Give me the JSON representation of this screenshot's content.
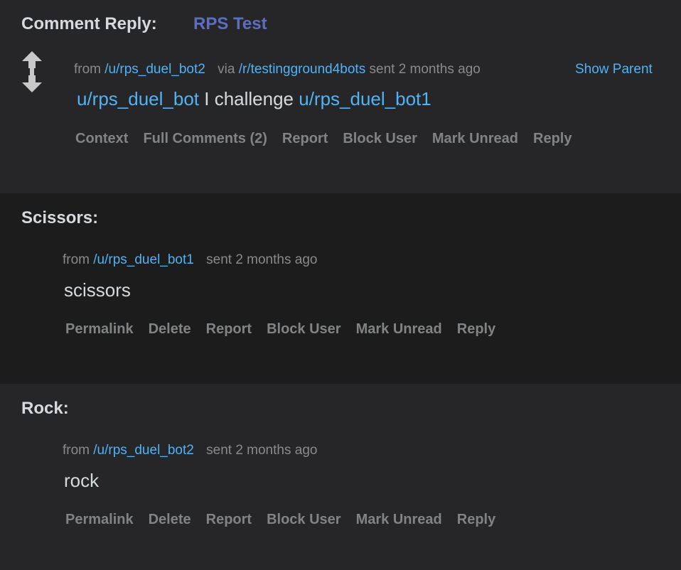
{
  "messages": [
    {
      "subject": "Comment Reply:",
      "subject_link": "RPS Test",
      "from_label": "from",
      "author": "/u/rps_duel_bot2",
      "via_label": "via",
      "subreddit": "/r/testingground4bots",
      "sent": "sent 2 months ago",
      "show_parent": "Show Parent",
      "body": {
        "mention1": "u/rps_duel_bot",
        "text": " I challenge ",
        "mention2": "u/rps_duel_bot1"
      },
      "buttons": [
        "Context",
        "Full Comments (2)",
        "Report",
        "Block User",
        "Mark Unread",
        "Reply"
      ]
    },
    {
      "subject": "Scissors:",
      "from_label": "from",
      "author": "/u/rps_duel_bot1",
      "sent": "sent 2 months ago",
      "body": "scissors",
      "buttons": [
        "Permalink",
        "Delete",
        "Report",
        "Block User",
        "Mark Unread",
        "Reply"
      ]
    },
    {
      "subject": "Rock:",
      "from_label": "from",
      "author": "/u/rps_duel_bot2",
      "sent": "sent 2 months ago",
      "body": "rock",
      "buttons": [
        "Permalink",
        "Delete",
        "Report",
        "Block User",
        "Mark Unread",
        "Reply"
      ]
    }
  ],
  "icons": {
    "vote": "upvote-downvote-arrows-icon"
  },
  "colors": {
    "link": "#4fb3f5",
    "subject_link": "#5c6fbf",
    "button": "#818384",
    "text": "#d7dadc",
    "muted": "#8a8a8a"
  }
}
